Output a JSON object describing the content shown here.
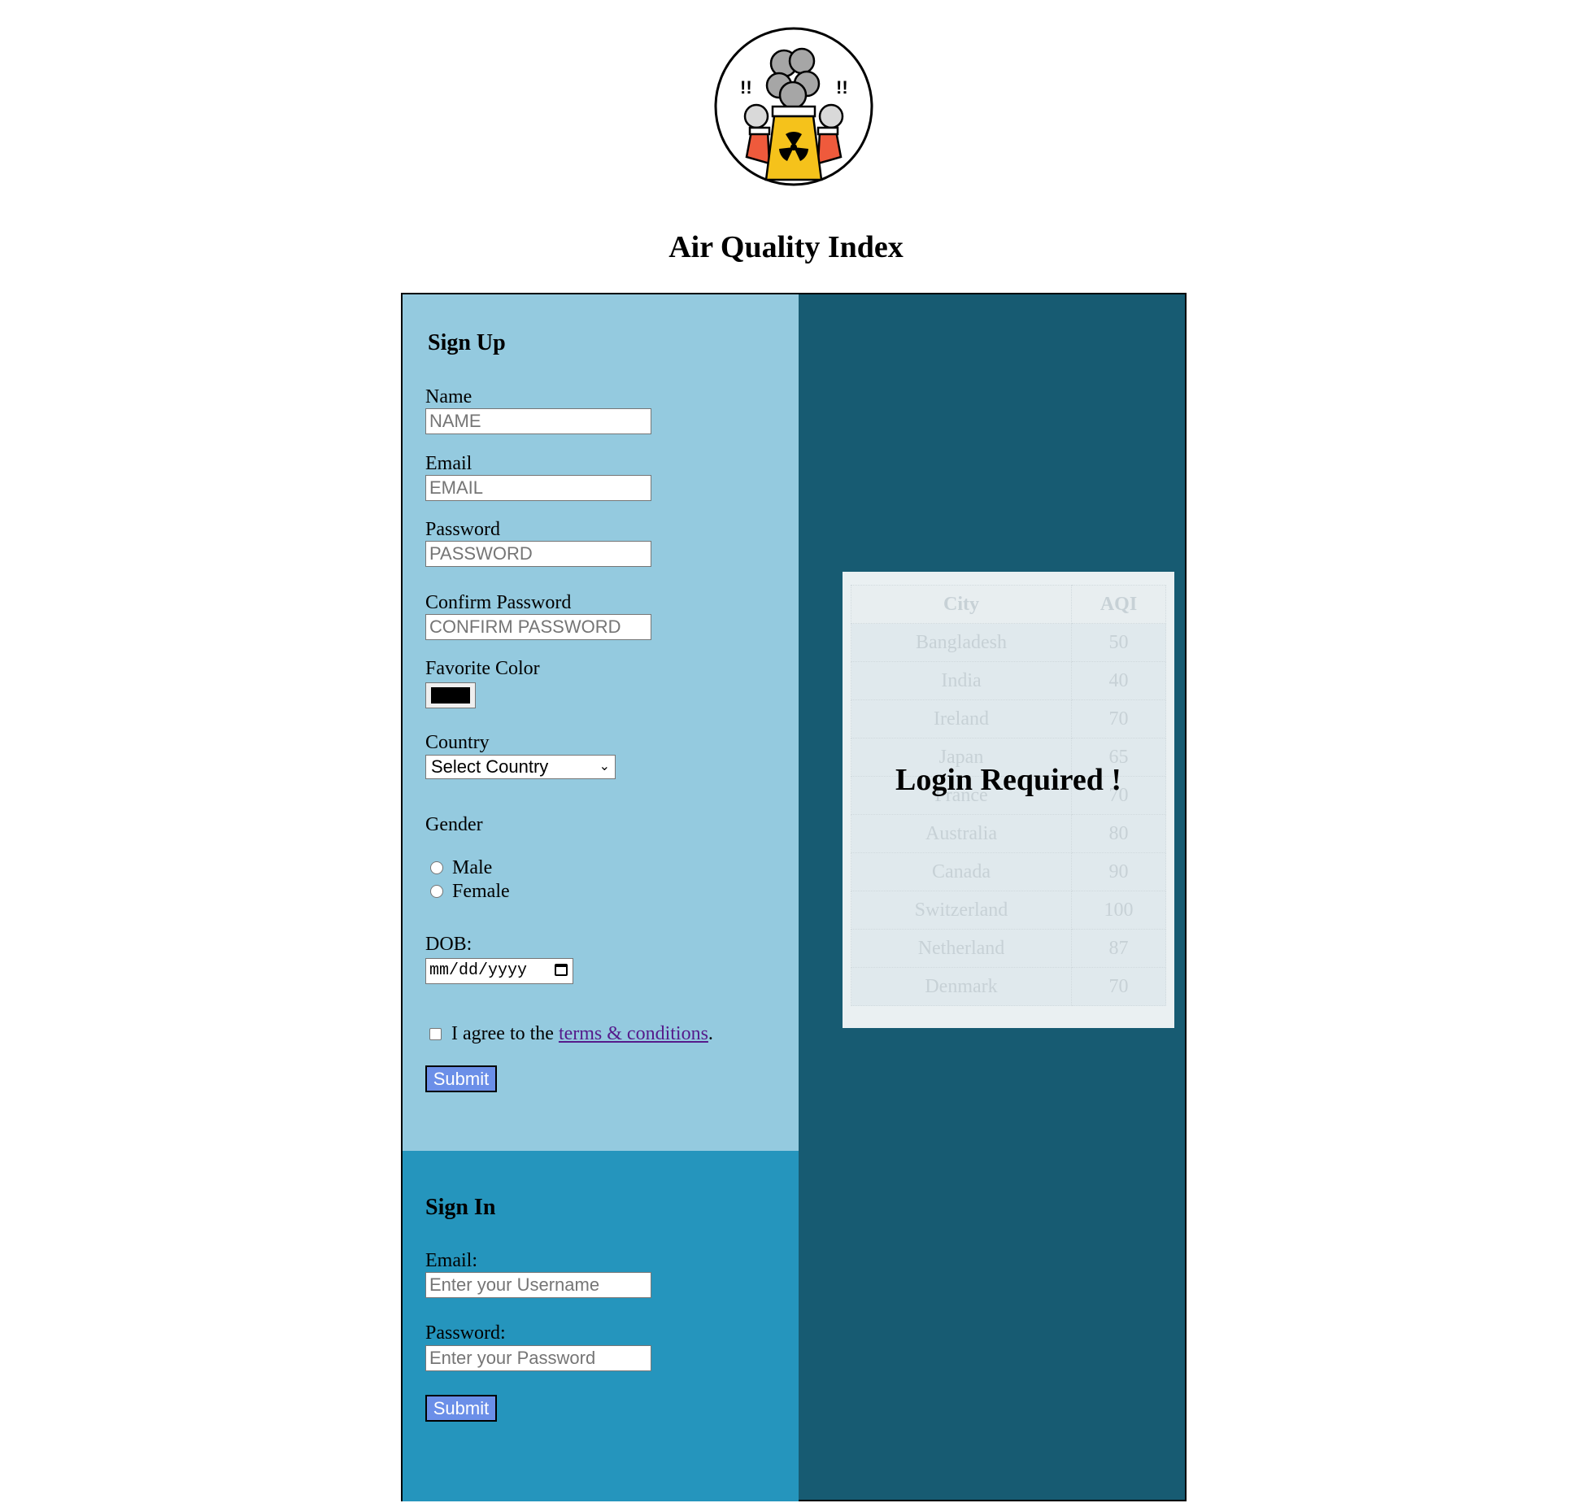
{
  "app": {
    "title": "Air Quality Index",
    "logo_icon": "factory-pollution-logo-icon"
  },
  "signup": {
    "heading": "Sign Up",
    "name_label": "Name",
    "name_placeholder": "NAME",
    "email_label": "Email",
    "email_placeholder": "EMAIL",
    "password_label": "Password",
    "password_placeholder": "PASSWORD",
    "confirm_label": "Confirm Password",
    "confirm_placeholder": "CONFIRM PASSWORD",
    "color_label": "Favorite Color",
    "color_value": "#000000",
    "country_label": "Country",
    "country_value": "Select Country",
    "gender_label": "Gender",
    "gender_options": [
      "Male",
      "Female"
    ],
    "dob_label": "DOB:",
    "dob_placeholder": "mm/dd/yyyy",
    "terms_prefix": "I agree to the ",
    "terms_link": "terms & conditions",
    "terms_suffix": ".",
    "submit_label": "Submit"
  },
  "signin": {
    "heading": "Sign In",
    "email_label": "Email:",
    "email_placeholder": "Enter your Username",
    "password_label": "Password:",
    "password_placeholder": "Enter your Password",
    "submit_label": "Submit"
  },
  "aqi_table": {
    "headers": [
      "City",
      "AQI"
    ],
    "rows": [
      [
        "Bangladesh",
        "50"
      ],
      [
        "India",
        "40"
      ],
      [
        "Ireland",
        "70"
      ],
      [
        "Japan",
        "65"
      ],
      [
        "France",
        "70"
      ],
      [
        "Australia",
        "80"
      ],
      [
        "Canada",
        "90"
      ],
      [
        "Switzerland",
        "100"
      ],
      [
        "Netherland",
        "87"
      ],
      [
        "Denmark",
        "70"
      ]
    ]
  },
  "overlay": {
    "message": "Login Required !"
  },
  "colors": {
    "signup_bg": "#94cadf",
    "signin_bg": "#2595bd",
    "content_bg": "#175b72",
    "button_bg": "#6b8fe8"
  }
}
